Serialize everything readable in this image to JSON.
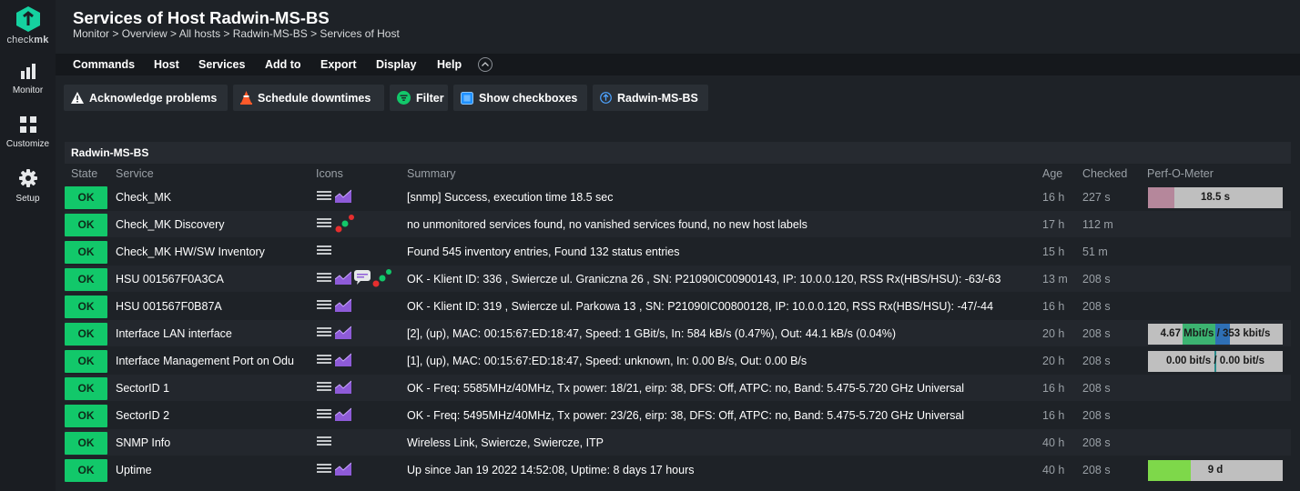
{
  "sidebar": {
    "logo_text_a": "check",
    "logo_text_b": "mk",
    "items": [
      {
        "label": "Monitor",
        "icon": "bar-chart-icon"
      },
      {
        "label": "Customize",
        "icon": "grid-icon"
      },
      {
        "label": "Setup",
        "icon": "gear-icon"
      }
    ]
  },
  "page": {
    "title": "Services of Host Radwin-MS-BS",
    "breadcrumb": "Monitor > Overview > All hosts > Radwin-MS-BS > Services of Host"
  },
  "menu": [
    "Commands",
    "Host",
    "Services",
    "Add to",
    "Export",
    "Display",
    "Help"
  ],
  "toolbar": {
    "acknowledge": "Acknowledge problems",
    "schedule": "Schedule downtimes",
    "filter": "Filter",
    "checkboxes": "Show checkboxes",
    "host": "Radwin-MS-BS"
  },
  "table": {
    "host": "Radwin-MS-BS",
    "headers": {
      "state": "State",
      "service": "Service",
      "icons": "Icons",
      "summary": "Summary",
      "age": "Age",
      "checked": "Checked",
      "perf": "Perf-O-Meter"
    },
    "rows": [
      {
        "state": "OK",
        "service": "Check_MK",
        "summary": "[snmp] Success, execution time 18.5 sec",
        "age": "16 h",
        "checked": "227 s",
        "perf": "18.5 s"
      },
      {
        "state": "OK",
        "service": "Check_MK Discovery",
        "summary": "no unmonitored services found, no vanished services found, no new host labels",
        "age": "17 h",
        "checked": "112 m",
        "perf": ""
      },
      {
        "state": "OK",
        "service": "Check_MK HW/SW Inventory",
        "summary": "Found 545 inventory entries, Found 132 status entries",
        "age": "15 h",
        "checked": "51 m",
        "perf": ""
      },
      {
        "state": "OK",
        "service": "HSU 001567F0A3CA",
        "summary": "OK - Klient ID: 336 , Swiercze ul. Graniczna 26 , SN: P21090IC00900143, IP: 10.0.0.120, RSS Rx(HBS/HSU): -63/-63",
        "age": "13 m",
        "checked": "208 s",
        "perf": ""
      },
      {
        "state": "OK",
        "service": "HSU 001567F0B87A",
        "summary": "OK - Klient ID: 319 , Swiercze ul. Parkowa 13 , SN: P21090IC00800128, IP: 10.0.0.120, RSS Rx(HBS/HSU): -47/-44",
        "age": "16 h",
        "checked": "208 s",
        "perf": ""
      },
      {
        "state": "OK",
        "service": "Interface LAN interface",
        "summary": "[2], (up), MAC: 00:15:67:ED:18:47, Speed: 1 GBit/s, In: 584 kB/s (0.47%), Out: 44.1 kB/s (0.04%)",
        "age": "20 h",
        "checked": "208 s",
        "perf": "4.67 Mbit/s / 353 kbit/s"
      },
      {
        "state": "OK",
        "service": "Interface Management Port on Odu",
        "summary": "[1], (up), MAC: 00:15:67:ED:18:47, Speed: unknown, In: 0.00 B/s, Out: 0.00 B/s",
        "age": "20 h",
        "checked": "208 s",
        "perf": "0.00 bit/s / 0.00 bit/s"
      },
      {
        "state": "OK",
        "service": "SectorID 1",
        "summary": "OK - Freq: 5585MHz/40MHz, Tx power: 18/21, eirp: 38, DFS: Off, ATPC: no, Band: 5.475-5.720 GHz Universal",
        "age": "16 h",
        "checked": "208 s",
        "perf": ""
      },
      {
        "state": "OK",
        "service": "SectorID 2",
        "summary": "OK - Freq: 5495MHz/40MHz, Tx power: 23/26, eirp: 38, DFS: Off, ATPC: no, Band: 5.475-5.720 GHz Universal",
        "age": "16 h",
        "checked": "208 s",
        "perf": ""
      },
      {
        "state": "OK",
        "service": "SNMP Info",
        "summary": "Wireless Link, Swiercze, Swiercze, ITP",
        "age": "40 h",
        "checked": "208 s",
        "perf": ""
      },
      {
        "state": "OK",
        "service": "Uptime",
        "summary": "Up since Jan 19 2022 14:52:08, Uptime: 8 days 17 hours",
        "age": "40 h",
        "checked": "208 s",
        "perf": "9 d"
      }
    ]
  },
  "colors": {
    "ok": "#12c86a",
    "accent": "#15d1a0",
    "graph": "#8e5bd8"
  }
}
